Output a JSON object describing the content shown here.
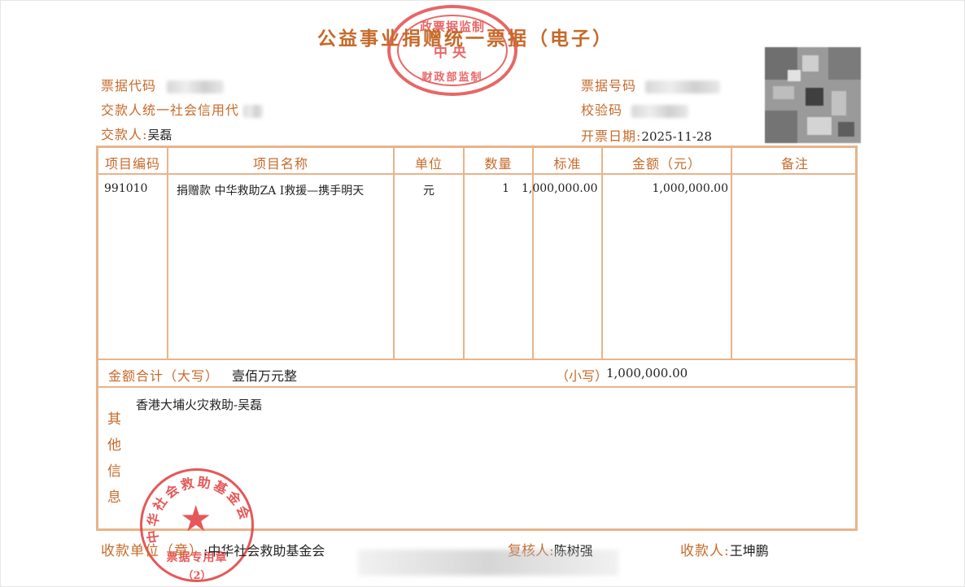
{
  "title": "公益事业捐赠统一票据（电子）",
  "header": {
    "bill_code_label": "票据代码",
    "payer_credit_label": "交款人统一社会信用代",
    "payer_label": "交款人:",
    "payer_value": "吴磊",
    "bill_number_label": "票据号码",
    "check_code_label": "校验码",
    "issue_date_label": "开票日期:",
    "issue_date_value": "2025-11-28"
  },
  "table": {
    "headers": [
      "项目编码",
      "项目名称",
      "单位",
      "数量",
      "标准",
      "金额（元）",
      "备注"
    ],
    "row": {
      "code": "991010",
      "name": "捐赠款  中华救助ZA I救援—携手明天",
      "unit": "元",
      "quantity": "1",
      "standard": "1,000,000.00",
      "amount": "1,000,000.00",
      "note": ""
    },
    "total_upper_label": "金额合计（大写）",
    "total_upper_value": "壹佰万元整",
    "total_lower_label": "（小写）",
    "total_lower_value": "1,000,000.00",
    "other_info_label": [
      "其",
      "他",
      "信",
      "息"
    ],
    "other_info_value": "香港大埔火灾救助-吴磊"
  },
  "stamps": {
    "top": {
      "line1": "政票据监制",
      "line2": "中央",
      "line3": "财政部监制"
    },
    "bottom": {
      "arc_text": "中华社会救助基金会",
      "line1": "票据专用章",
      "line2": "（2）"
    }
  },
  "footer": {
    "payee_unit_label": "收款单位（章）",
    "payee_unit_value": ":中华社会救助基金会",
    "reviewer_label": "复核人:",
    "reviewer_value": "陈树强",
    "cashier_label": "收款人:",
    "cashier_value": "王坤鹏"
  },
  "colors": {
    "label": "#c66a2a",
    "table_border": "#e8b48a",
    "stamp_red": "#e23c3c"
  }
}
